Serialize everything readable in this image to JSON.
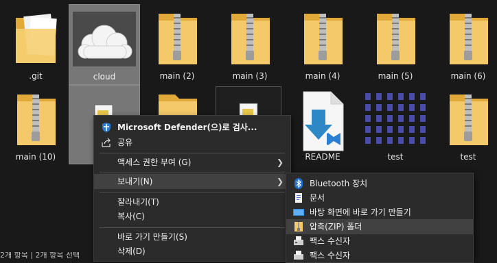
{
  "files": [
    {
      "name": ".git",
      "icon": "folder-icon"
    },
    {
      "name": "cloud",
      "icon": "cloud-image-icon"
    },
    {
      "name": "main (2)",
      "icon": "zip-folder-icon"
    },
    {
      "name": "main (3)",
      "icon": "zip-folder-icon"
    },
    {
      "name": "main (4)",
      "icon": "zip-folder-icon"
    },
    {
      "name": "main (5)",
      "icon": "zip-folder-icon"
    },
    {
      "name": "main (6)",
      "icon": "zip-folder-icon"
    },
    {
      "name": "main (10)",
      "icon": "zip-folder-icon"
    },
    {
      "name": "README",
      "icon": "vscode-file-icon"
    },
    {
      "name": "test",
      "icon": "sprite-sheet-image-icon"
    },
    {
      "name": "test",
      "icon": "zip-folder-icon"
    }
  ],
  "context_menu": {
    "defender": "Microsoft Defender(으)로 검사...",
    "share": "공유",
    "grant_access": "액세스 권한 부여 (G)",
    "send_to": "보내기(N)",
    "cut": "잘라내기(T)",
    "copy": "복사(C)",
    "create_shortcut": "바로 가기 만들기(S)",
    "delete": "삭제(D)"
  },
  "send_to_menu": {
    "bluetooth": "Bluetooth 장치",
    "documents": "문서",
    "desktop_shortcut": "바탕 화면에 바로 가기 만들기",
    "zip": "압축(ZIP) 폴더",
    "fax1": "팩스 수신자",
    "fax2": "팩스 수신자"
  },
  "status_bar": "2개 항목 | 2개 항목 선택",
  "colors": {
    "background": "#191919",
    "menu_bg": "#2b2b2b",
    "menu_highlight": "#414141",
    "folder_yellow": "#f3c969",
    "selection": "#777777"
  }
}
